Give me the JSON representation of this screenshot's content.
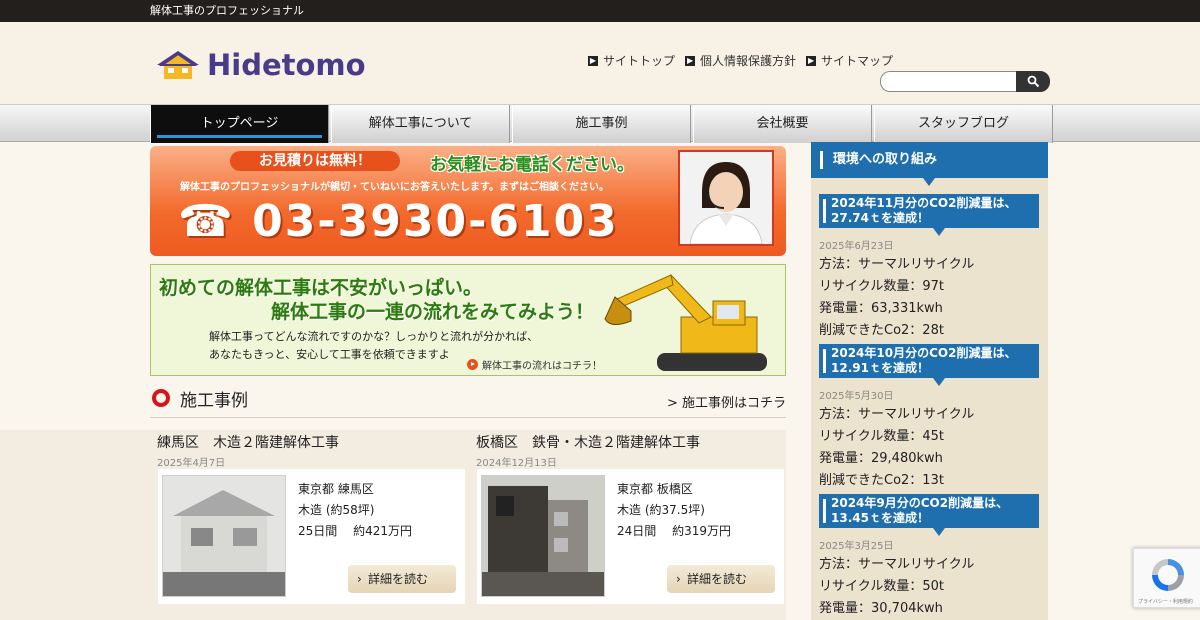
{
  "topstrip": {
    "text": "解体工事のプロフェッショナル"
  },
  "header": {
    "logo_text": "Hidetomo",
    "util_links": [
      "サイトトップ",
      "個人情報保護方針",
      "サイトマップ"
    ],
    "search": {
      "placeholder": ""
    }
  },
  "nav": {
    "items": [
      "トップページ",
      "解体工事について",
      "施工事例",
      "会社概要",
      "スタッフブログ"
    ]
  },
  "banner_phone": {
    "pill": "お見積りは無料！",
    "call_text": "お気軽にお電話ください。",
    "sub": "解体工事のプロフェッショナルが親切・ていねいにお答えいたします。まずはご相談ください。",
    "tel": "☎ 03-3930-6103"
  },
  "banner_flow": {
    "line1": "初めての解体工事は不安がいっぱい。",
    "line2": "解体工事の一連の流れをみてみよう！",
    "desc1": "解体工事ってどんな流れですのかな？しっかりと流れが分かれば、",
    "desc2": "あなたもきっと、安心して工事を依頼できますよ",
    "link": "解体工事の流れはコチラ！"
  },
  "cases_section": {
    "title": "施工事例",
    "more": "> 施工事例はコチラ",
    "items": [
      {
        "title": "練馬区　木造２階建解体工事",
        "date": "2025年4月7日",
        "location": "東京都 練馬区",
        "structure": "木造 (約58坪)",
        "period": "25日間　 約421万円",
        "button": "詳細を読む"
      },
      {
        "title": "板橋区　鉄骨・木造２階建解体工事",
        "date": "2024年12月13日",
        "location": "東京都 板橋区",
        "structure": "木造 (約37.5坪)",
        "period": "24日間　 約319万円",
        "button": "詳細を読む"
      }
    ]
  },
  "sidebar": {
    "title": "環境への取り組み",
    "entries": [
      {
        "tag": "2024年11月分のCO2削減量は、27.74ｔを達成！",
        "date": "2025年6月23日",
        "lines": [
          "方法：サーマルリサイクル",
          "リサイクル数量：97t",
          "発電量：63,331kwh",
          "削減できたCo2：28t"
        ]
      },
      {
        "tag": "2024年10月分のCO2削減量は、12.91ｔを達成！",
        "date": "2025年5月30日",
        "lines": [
          "方法：サーマルリサイクル",
          "リサイクル数量：45t",
          "発電量：29,480kwh",
          "削減できたCo2：13t"
        ]
      },
      {
        "tag": "2024年9月分のCO2削減量は、13.45ｔを達成！",
        "date": "2025年3月25日",
        "lines": [
          "方法：サーマルリサイクル",
          "リサイクル数量：50t",
          "発電量：30,704kwh"
        ]
      }
    ]
  },
  "recaptcha": {
    "text": "プライバシー・利用規約"
  },
  "colors": {
    "nav_active": "#0e0e0e",
    "accent_blue": "#1f6fae",
    "orange": "#f26a2c",
    "green": "#2d7a10",
    "logo": "#4a3a8a"
  }
}
